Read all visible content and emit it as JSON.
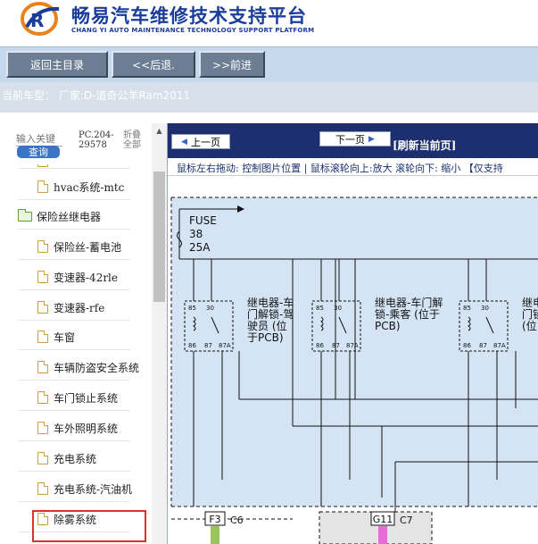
{
  "header": {
    "title": "畅易汽车维修技术支持平台",
    "subtitle": "CHANG YI AUTO MAINTENANCE TECHNOLOGY SUPPORT PLATFORM"
  },
  "toolbar": {
    "home_label": "返回主目录",
    "back_label": "<<后退.",
    "forward_label": ">>前进"
  },
  "vehicle": {
    "label": "当前车型： 厂家:D-道奇公羊Ram2011"
  },
  "search": {
    "placeholder": "输入关键",
    "button_label": "查询",
    "doc_code": "PC.204-\n29578",
    "fold_all_label": "折叠全部"
  },
  "tree": {
    "items": [
      {
        "label": "hvac系统-mtc",
        "type": "file"
      },
      {
        "label": "保险丝继电器",
        "type": "folder"
      },
      {
        "label": "保险丝-蓄电池",
        "type": "file"
      },
      {
        "label": "变速器-42rle",
        "type": "file"
      },
      {
        "label": "变速器-rfe",
        "type": "file"
      },
      {
        "label": "车窗",
        "type": "file"
      },
      {
        "label": "车辆防盗安全系统",
        "type": "file"
      },
      {
        "label": "车门锁止系统",
        "type": "file",
        "selected": true
      },
      {
        "label": "车外照明系统",
        "type": "file"
      },
      {
        "label": "充电系统",
        "type": "file"
      },
      {
        "label": "充电系统-汽油机",
        "type": "file"
      },
      {
        "label": "除雾系统",
        "type": "file"
      }
    ]
  },
  "viewer": {
    "prev_label": "上一页",
    "next_label": "下一页",
    "refresh_label": "[刷新当前页]",
    "hint": "鼠标左右拖动: 控制图片位置 | 鼠标滚轮向上:放大  滚轮向下: 缩小 【仅支持"
  },
  "diagram": {
    "fuse_name": "FUSE",
    "fuse_number": "38",
    "fuse_amps": "25A",
    "relays": [
      {
        "label_lines": [
          "继电器-车",
          "门解锁-驾",
          "驶员 (位",
          "于PCB)"
        ]
      },
      {
        "label_lines": [
          "继电器-车门解",
          "锁-乘客 (位于",
          "PCB)"
        ]
      },
      {
        "label_lines": [
          "继电",
          "门锁",
          "(位"
        ]
      }
    ],
    "pin_labels": {
      "p85": "85",
      "p30": "30",
      "p86": "86",
      "p87": "87",
      "p87a": "87A"
    },
    "connectors": [
      {
        "pin": "F3",
        "name": "C6"
      },
      {
        "pin": "G11",
        "name": "C7"
      }
    ],
    "colors": {
      "background": "#d4e4f4",
      "line": "#111111",
      "wire_green": "#9bc45a",
      "wire_pink": "#e86ad6"
    }
  }
}
